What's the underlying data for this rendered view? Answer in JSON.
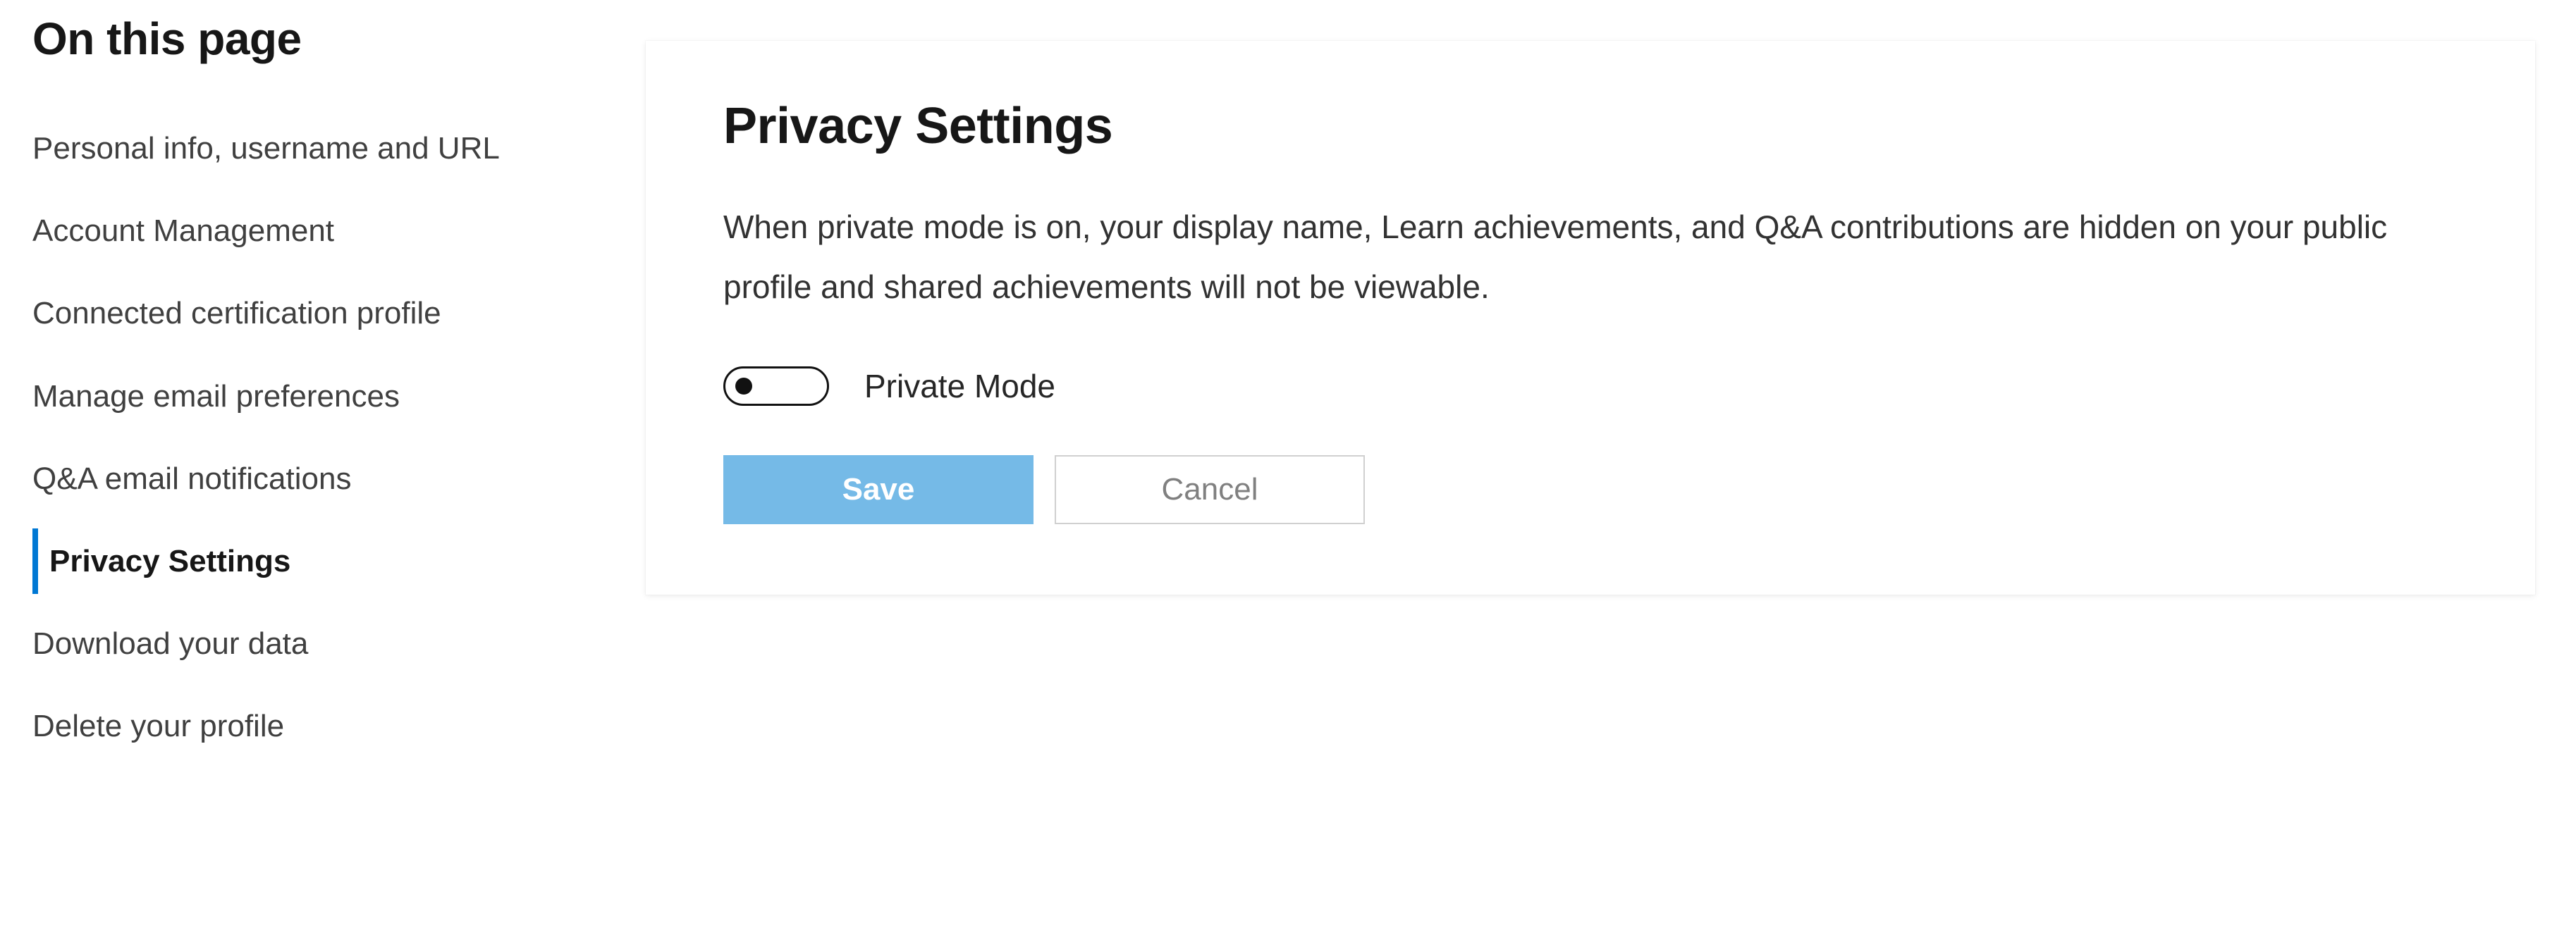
{
  "sidebar": {
    "title": "On this page",
    "items": [
      {
        "label": "Personal info, username and URL",
        "active": false
      },
      {
        "label": "Account Management",
        "active": false
      },
      {
        "label": "Connected certification profile",
        "active": false
      },
      {
        "label": "Manage email preferences",
        "active": false
      },
      {
        "label": "Q&A email notifications",
        "active": false
      },
      {
        "label": "Privacy Settings",
        "active": true
      },
      {
        "label": "Download your data",
        "active": false
      },
      {
        "label": "Delete your profile",
        "active": false
      }
    ]
  },
  "main": {
    "title": "Privacy Settings",
    "description": "When private mode is on, your display name, Learn achievements, and Q&A contributions are hidden on your public profile and shared achievements will not be viewable.",
    "toggle": {
      "label": "Private Mode",
      "checked": false
    },
    "save_label": "Save",
    "cancel_label": "Cancel"
  }
}
